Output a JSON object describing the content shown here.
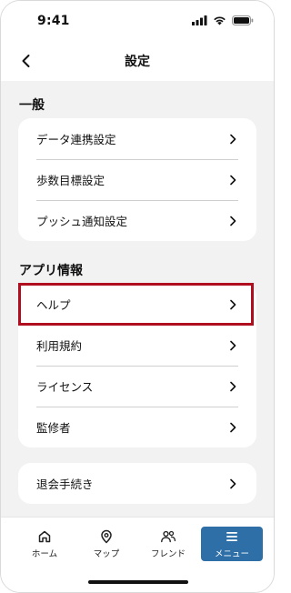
{
  "status_bar": {
    "time": "9:41"
  },
  "header": {
    "title": "設定",
    "back_icon": "chevron-left-icon"
  },
  "sections": {
    "general": {
      "title": "一般",
      "items": [
        {
          "label": "データ連携設定"
        },
        {
          "label": "歩数目標設定"
        },
        {
          "label": "プッシュ通知設定"
        }
      ]
    },
    "app_info": {
      "title": "アプリ情報",
      "items": [
        {
          "label": "ヘルプ"
        },
        {
          "label": "利用規約"
        },
        {
          "label": "ライセンス"
        },
        {
          "label": "監修者"
        }
      ]
    },
    "account": {
      "items": [
        {
          "label": "退会手続き"
        }
      ]
    }
  },
  "tab_bar": {
    "tabs": [
      {
        "label": "ホーム",
        "icon": "home-icon"
      },
      {
        "label": "マップ",
        "icon": "map-pin-icon"
      },
      {
        "label": "フレンド",
        "icon": "friends-icon"
      },
      {
        "label": "メニュー",
        "icon": "menu-icon",
        "active": true
      }
    ]
  },
  "colors": {
    "accent": "#2e6fa7",
    "highlight_border": "#b00d1f",
    "background": "#f2f2f2"
  }
}
